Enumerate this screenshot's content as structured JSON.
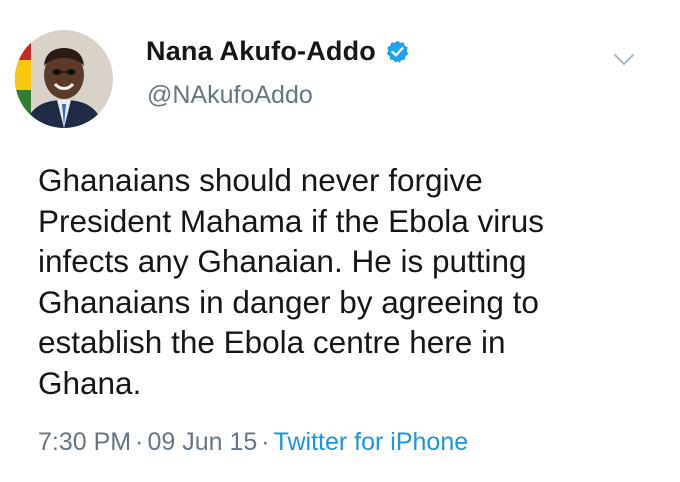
{
  "user": {
    "display_name": "Nana Akufo-Addo",
    "handle": "@NAkufoAddo",
    "verified": true,
    "avatar_icon": "profile-photo"
  },
  "tweet": {
    "text": "Ghanaians should never forgive\nPresident Mahama if the Ebola virus\ninfects any Ghanaian. He is putting\nGhanaians in danger by agreeing to\nestablish the Ebola centre here in\nGhana."
  },
  "meta": {
    "time": "7:30 PM",
    "separator": "·",
    "date": "09 Jun 15",
    "source": "Twitter for iPhone"
  },
  "icons": {
    "verified": "verified-badge-icon",
    "menu": "chevron-down-icon"
  },
  "colors": {
    "text": "#14171a",
    "muted": "#657786",
    "link": "#1b95e0",
    "verified": "#1da1f2"
  }
}
